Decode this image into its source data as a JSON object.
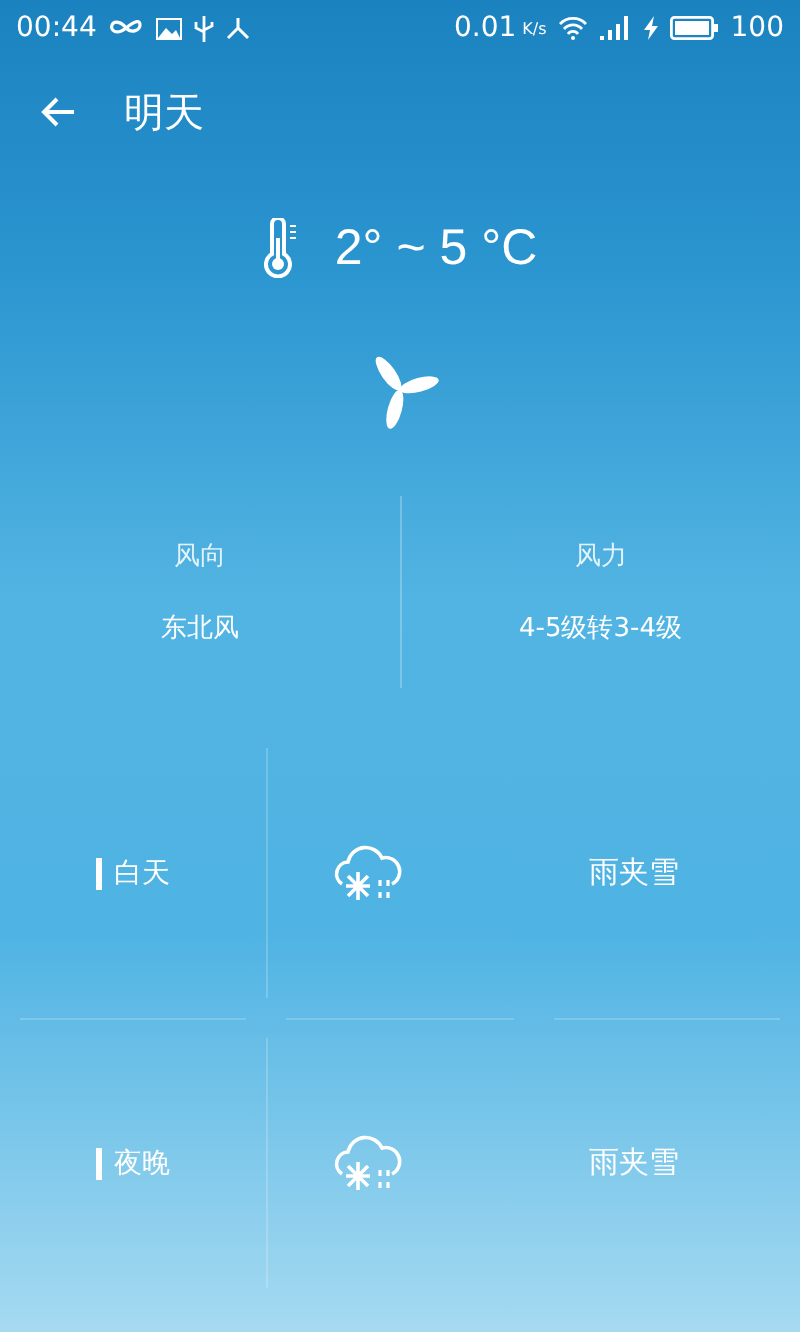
{
  "status_bar": {
    "time": "00:44",
    "speed": "0.01",
    "speed_unit": "K/s",
    "battery": "100"
  },
  "header": {
    "title": "明天"
  },
  "temperature": "2° ~ 5 °C",
  "wind": [
    {
      "label": "风向",
      "value": "东北风"
    },
    {
      "label": "风力",
      "value": "4-5级转3-4级"
    }
  ],
  "periods": [
    {
      "label": "白天",
      "kind": "sleet",
      "condition": "雨夹雪"
    },
    {
      "label": "夜晚",
      "kind": "sleet",
      "condition": "雨夹雪"
    }
  ]
}
